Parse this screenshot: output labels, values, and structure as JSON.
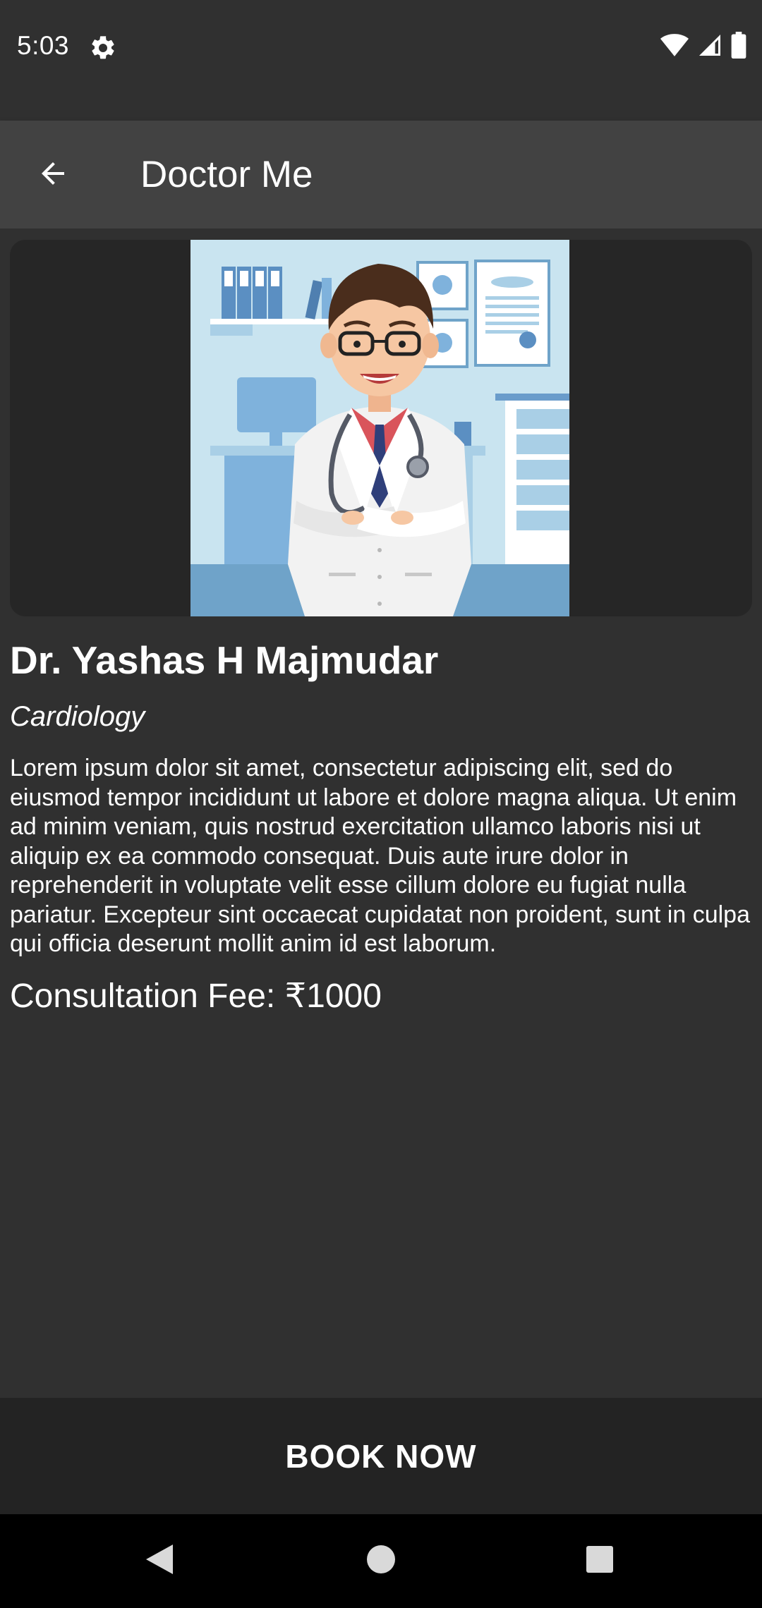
{
  "status_bar": {
    "time": "5:03",
    "icons": [
      "settings-icon",
      "wifi-icon",
      "signal-icon",
      "battery-icon"
    ]
  },
  "app_bar": {
    "title": "Doctor Me",
    "back_icon": "arrow-back-icon"
  },
  "doctor": {
    "name": "Dr. Yashas H Majmudar",
    "specialty": "Cardiology",
    "description": "Lorem ipsum dolor sit amet, consectetur adipiscing elit, sed do eiusmod tempor incididunt ut labore et dolore magna aliqua. Ut enim ad minim veniam, quis nostrud exercitation ullamco laboris nisi ut aliquip ex ea commodo consequat. Duis aute irure dolor in reprehenderit in voluptate velit esse cillum dolore eu fugiat nulla pariatur. Excepteur sint occaecat cupidatat non proident, sunt in culpa qui officia deserunt mollit anim id est laborum.",
    "fee_label": "Consultation Fee: ",
    "fee_value": "₹1000",
    "image": "doctor-illustration"
  },
  "actions": {
    "book_label": "BOOK NOW"
  },
  "nav_bar": {
    "buttons": [
      "back-triangle-icon",
      "home-circle-icon",
      "recents-square-icon"
    ]
  },
  "colors": {
    "background": "#303030",
    "app_bar": "#424242",
    "image_card": "#262626",
    "book_bar": "#232323",
    "nav_bar": "#000000",
    "text": "#ffffff"
  }
}
